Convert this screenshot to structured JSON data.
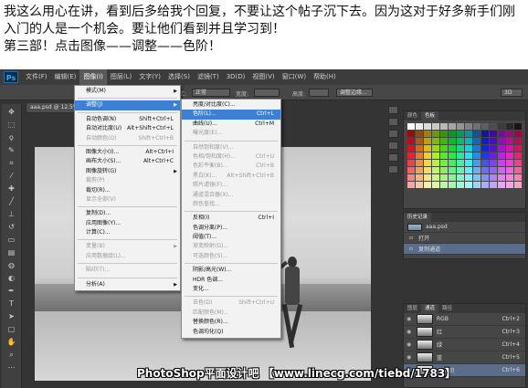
{
  "intro": {
    "line1": "我这么用心在讲，看到后多给我个回复，不要让这个帖子沉下去。因为这对于好多新手们刚",
    "line2": "入门的人是一个机会。要让他们看到并且学习到！",
    "line3": "第三部！点击图像——调整——色阶！"
  },
  "app": {
    "logo": "Ps",
    "menubar": [
      "文件(F)",
      "编辑(E)",
      "图像(I)",
      "图层(L)",
      "文字(Y)",
      "选择(S)",
      "滤镜(T)",
      "3D(D)",
      "视图(V)",
      "窗口(W)",
      "帮助(H)"
    ],
    "active_menu_index": 2,
    "options": {
      "mode_label": "样式:",
      "mode_value": "正常",
      "width_label": "宽度:",
      "height_label": "高度:",
      "refine_button": "调整边缘...",
      "workspace": "3D"
    },
    "doc_tab": "aaa.psd @ 12.5%"
  },
  "image_menu": [
    {
      "label": "模式(M)",
      "shortcut": "",
      "arrow": true,
      "disabled": false,
      "sep_after": true
    },
    {
      "label": "调整(J)",
      "shortcut": "",
      "arrow": true,
      "disabled": false,
      "highlight": true,
      "sep_after": true
    },
    {
      "label": "自动色调(N)",
      "shortcut": "Shift+Ctrl+L",
      "disabled": false
    },
    {
      "label": "自动对比度(U)",
      "shortcut": "Alt+Shift+Ctrl+L",
      "disabled": false
    },
    {
      "label": "自动颜色(O)",
      "shortcut": "Shift+Ctrl+B",
      "disabled": true,
      "sep_after": true
    },
    {
      "label": "图像大小(I)...",
      "shortcut": "Alt+Ctrl+I",
      "disabled": false
    },
    {
      "label": "画布大小(S)...",
      "shortcut": "Alt+Ctrl+C",
      "disabled": false
    },
    {
      "label": "图像旋转(G)",
      "shortcut": "",
      "arrow": true,
      "disabled": false
    },
    {
      "label": "裁剪(P)",
      "shortcut": "",
      "disabled": true
    },
    {
      "label": "裁切(R)...",
      "shortcut": "",
      "disabled": false
    },
    {
      "label": "显示全部(V)",
      "shortcut": "",
      "disabled": true,
      "sep_after": true
    },
    {
      "label": "复制(D)...",
      "shortcut": "",
      "disabled": false
    },
    {
      "label": "应用图像(Y)...",
      "shortcut": "",
      "disabled": false
    },
    {
      "label": "计算(C)...",
      "shortcut": "",
      "disabled": false,
      "sep_after": true
    },
    {
      "label": "变量(B)",
      "shortcut": "",
      "arrow": true,
      "disabled": true
    },
    {
      "label": "应用数据组(L)...",
      "shortcut": "",
      "disabled": true,
      "sep_after": true
    },
    {
      "label": "陷印(T)...",
      "shortcut": "",
      "disabled": true,
      "sep_after": true
    },
    {
      "label": "分析(A)",
      "shortcut": "",
      "arrow": true,
      "disabled": false
    }
  ],
  "adjust_menu": [
    {
      "label": "亮度/对比度(C)...",
      "shortcut": "",
      "disabled": false
    },
    {
      "label": "色阶(L)...",
      "shortcut": "Ctrl+L",
      "disabled": false,
      "highlight": true
    },
    {
      "label": "曲线(U)...",
      "shortcut": "Ctrl+M",
      "disabled": false
    },
    {
      "label": "曝光度(E)...",
      "shortcut": "",
      "disabled": true,
      "sep_after": true
    },
    {
      "label": "自然饱和度(V)...",
      "shortcut": "",
      "disabled": true
    },
    {
      "label": "色相/饱和度(H)...",
      "shortcut": "Ctrl+U",
      "disabled": true
    },
    {
      "label": "色彩平衡(B)...",
      "shortcut": "Ctrl+B",
      "disabled": true
    },
    {
      "label": "黑白(K)...",
      "shortcut": "Alt+Shift+Ctrl+B",
      "disabled": true
    },
    {
      "label": "照片滤镜(F)...",
      "shortcut": "",
      "disabled": true
    },
    {
      "label": "通道混合器(X)...",
      "shortcut": "",
      "disabled": true
    },
    {
      "label": "颜色查找...",
      "shortcut": "",
      "disabled": true,
      "sep_after": true
    },
    {
      "label": "反相(I)",
      "shortcut": "Ctrl+I",
      "disabled": false
    },
    {
      "label": "色调分离(P)...",
      "shortcut": "",
      "disabled": false
    },
    {
      "label": "阈值(T)...",
      "shortcut": "",
      "disabled": false
    },
    {
      "label": "渐变映射(G)...",
      "shortcut": "",
      "disabled": true
    },
    {
      "label": "可选颜色(S)...",
      "shortcut": "",
      "disabled": true,
      "sep_after": true
    },
    {
      "label": "阴影/高光(W)...",
      "shortcut": "",
      "disabled": false
    },
    {
      "label": "HDR 色调...",
      "shortcut": "",
      "disabled": false
    },
    {
      "label": "变化...",
      "shortcut": "",
      "disabled": false,
      "sep_after": true
    },
    {
      "label": "去色(D)",
      "shortcut": "Shift+Ctrl+U",
      "disabled": true
    },
    {
      "label": "匹配颜色(M)...",
      "shortcut": "",
      "disabled": true
    },
    {
      "label": "替换颜色(R)...",
      "shortcut": "",
      "disabled": false
    },
    {
      "label": "色调均化(Q)",
      "shortcut": "",
      "disabled": false
    }
  ],
  "swatches_panel": {
    "tabs": [
      "颜色",
      "色板"
    ],
    "active_tab": 1
  },
  "history_panel": {
    "tabs": [
      "历史记录"
    ],
    "items": [
      {
        "label": "aaa.psd",
        "thumb": true
      },
      {
        "label": "打开",
        "thumb": false
      },
      {
        "label": "复制通道",
        "thumb": false,
        "selected": true
      }
    ]
  },
  "channels_panel": {
    "tabs": [
      "图层",
      "通道",
      "路径"
    ],
    "active_tab": 1,
    "items": [
      {
        "label": "RGB",
        "shortcut": "Ctrl+2"
      },
      {
        "label": "红",
        "shortcut": "Ctrl+3"
      },
      {
        "label": "绿",
        "shortcut": "Ctrl+4"
      },
      {
        "label": "蓝",
        "shortcut": "Ctrl+5"
      },
      {
        "label": "蓝 拷贝",
        "shortcut": "Ctrl+6",
        "selected": true
      }
    ]
  },
  "watermark": "PhotoShop平面设计吧 【www.linecg.com/tiebd/1783】",
  "colors": {
    "accent": "#3d7fd1",
    "menubar": "#3c3c3c",
    "panel": "#464646"
  }
}
